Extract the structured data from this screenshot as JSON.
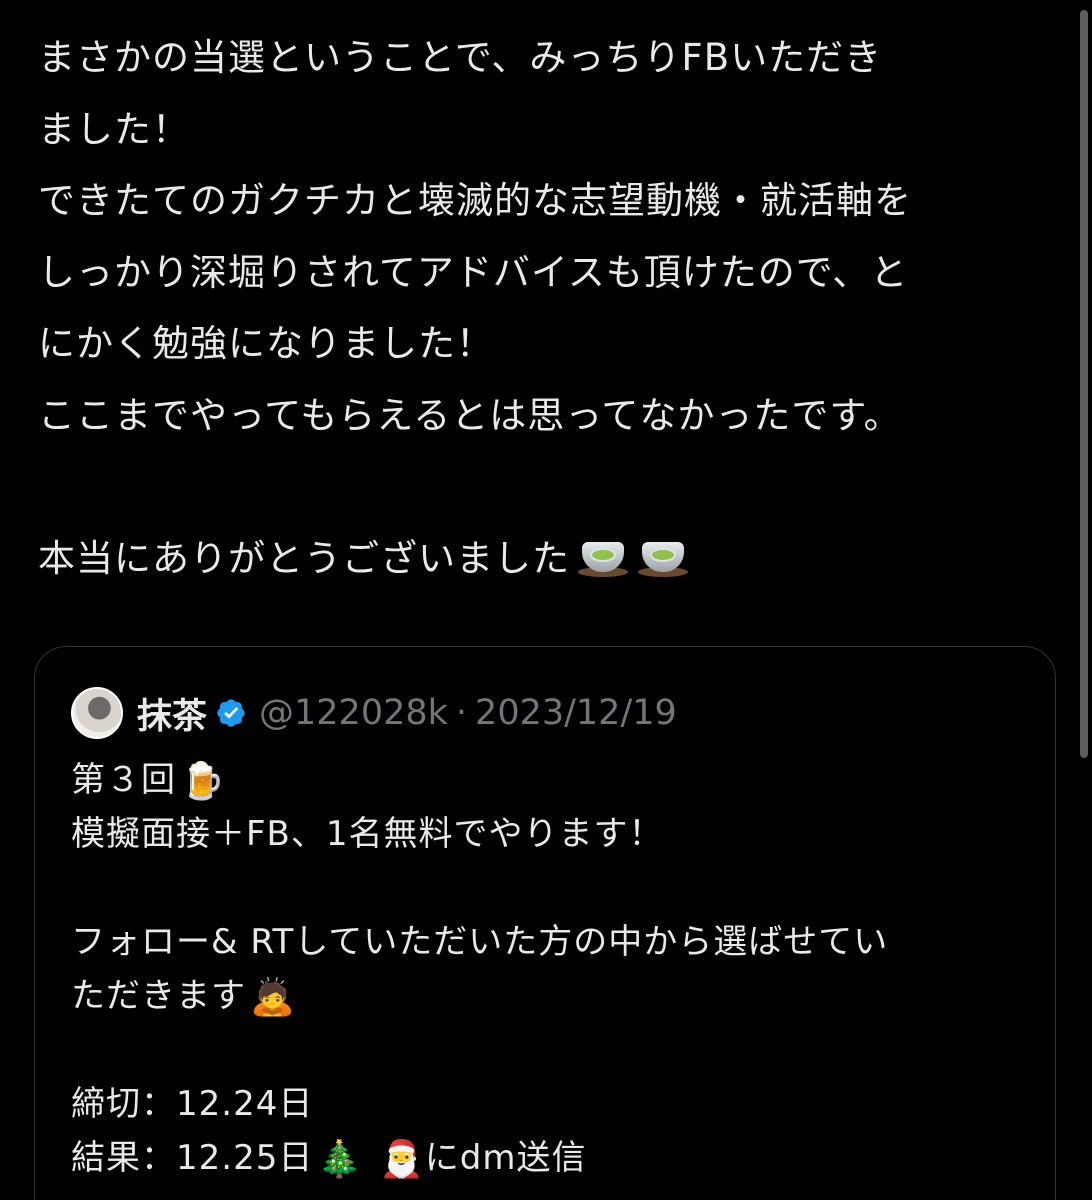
{
  "post": {
    "lines": [
      "まさかの当選ということで、みっちりFBいただき",
      "ました！",
      "できたてのガクチカと壊滅的な志望動機・就活軸を",
      "しっかり深堀りされてアドバイスも頂けたので、と",
      "にかく勉強になりました！",
      "ここまでやってもらえるとは思ってなかったです。"
    ],
    "thanks": "本当にありがとうございました",
    "thanks_icons": [
      "green-tea-icon",
      "green-tea-icon"
    ]
  },
  "quote": {
    "author_name": "抹茶",
    "handle": "@122028k",
    "separator": "·",
    "date": "2023/12/19",
    "verified_color": "#1d9bf0",
    "lines": {
      "l1": "第３回",
      "l1_emoji": "🍺",
      "l2": "模擬面接＋FB、1名無料でやります！",
      "l3": "フォロー& RTしていただいた方の中から選ばせてい",
      "l4": "ただきます",
      "l4_emoji": "🙇",
      "l5": "締切：12.24日",
      "l6_pre": "結果：12.25日",
      "l6_emoji1": "🎄",
      "l6_emoji2": "🎅",
      "l6_post": "にdm送信"
    }
  },
  "colors": {
    "background": "#000000",
    "text": "#e7e9ea",
    "muted": "#71767b",
    "border": "#2f3336"
  }
}
